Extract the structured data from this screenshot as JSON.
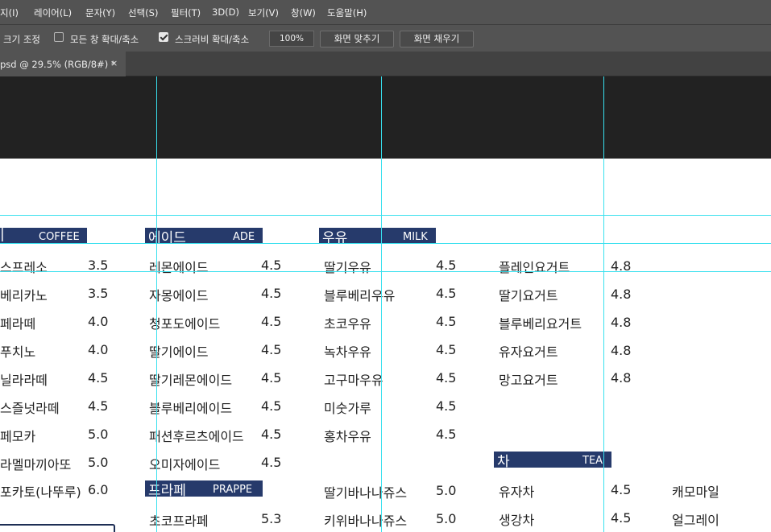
{
  "menubar": {
    "items": [
      "지(I)",
      "레이어(L)",
      "문자(Y)",
      "선택(S)",
      "필터(T)",
      "3D(D)",
      "보기(V)",
      "창(W)",
      "도움말(H)"
    ]
  },
  "options": {
    "resize_label": "크기 조정",
    "zoom_all_label": "모든 창 확대/축소",
    "zoom_all_checked": false,
    "scrubby_label": "스크러비 확대/축소",
    "scrubby_checked": true,
    "zoom_value": "100%",
    "fit_screen_label": "화면 맞추기",
    "fill_screen_label": "화면 채우기"
  },
  "tab": {
    "title": "psd @ 29.5% (RGB/8#) *",
    "close": "×"
  },
  "colors": {
    "header_bg": "#263a6b",
    "guide": "#38e0ee",
    "banner": "#222222"
  },
  "sections": {
    "coffee": {
      "ko": "|",
      "en": "COFFEE"
    },
    "ade": {
      "ko": "에이드",
      "en": "ADE"
    },
    "milk": {
      "ko": "우유",
      "en": "MILK"
    },
    "frappe": {
      "ko": "프라페",
      "en": "PRAPPE"
    },
    "tea": {
      "ko": "차",
      "en": "TEA"
    }
  },
  "coffee_items": [
    {
      "name": "스프레소",
      "price": "3.5"
    },
    {
      "name": "베리카노",
      "price": "3.5"
    },
    {
      "name": "페라떼",
      "price": "4.0"
    },
    {
      "name": "푸치노",
      "price": "4.0"
    },
    {
      "name": "닐라라떼",
      "price": "4.5"
    },
    {
      "name": "스즐넛라떼",
      "price": "4.5"
    },
    {
      "name": "페모카",
      "price": "5.0"
    },
    {
      "name": "라멜마끼아또",
      "price": "5.0"
    },
    {
      "name": "포카토(나뚜루)",
      "price": "6.0"
    }
  ],
  "ade_items": [
    {
      "name": "레몬에이드",
      "price": "4.5"
    },
    {
      "name": "자몽에이드",
      "price": "4.5"
    },
    {
      "name": "청포도에이드",
      "price": "4.5"
    },
    {
      "name": "딸기에이드",
      "price": "4.5"
    },
    {
      "name": "딸기레몬에이드",
      "price": "4.5"
    },
    {
      "name": "블루베리에이드",
      "price": "4.5"
    },
    {
      "name": "패션후르츠에이드",
      "price": "4.5"
    },
    {
      "name": "오미자에이드",
      "price": "4.5"
    }
  ],
  "frappe_items": [
    {
      "name": "초코프라페",
      "price": "5.3"
    }
  ],
  "milk_items": [
    {
      "name": "딸기우유",
      "price": "4.5"
    },
    {
      "name": "블루베리우유",
      "price": "4.5"
    },
    {
      "name": "초코우유",
      "price": "4.5"
    },
    {
      "name": "녹차우유",
      "price": "4.5"
    },
    {
      "name": "고구마우유",
      "price": "4.5"
    },
    {
      "name": "미숫가루",
      "price": "4.5"
    },
    {
      "name": "홍차우유",
      "price": "4.5"
    },
    {
      "name": "딸기바나나쥬스",
      "price": "5.0"
    },
    {
      "name": "키위바나나쥬스",
      "price": "5.0"
    }
  ],
  "yogurt_items": [
    {
      "name": "플레인요거트",
      "price": "4.8"
    },
    {
      "name": "딸기요거트",
      "price": "4.8"
    },
    {
      "name": "블루베리요거트",
      "price": "4.8"
    },
    {
      "name": "유자요거트",
      "price": "4.8"
    },
    {
      "name": "망고요거트",
      "price": "4.8"
    }
  ],
  "tea_items": [
    {
      "name": "유자차",
      "price": "4.5"
    },
    {
      "name": "생강차",
      "price": "4.5"
    }
  ],
  "tea_extra_items": [
    {
      "name": "캐모마일"
    },
    {
      "name": "얼그레이"
    }
  ]
}
